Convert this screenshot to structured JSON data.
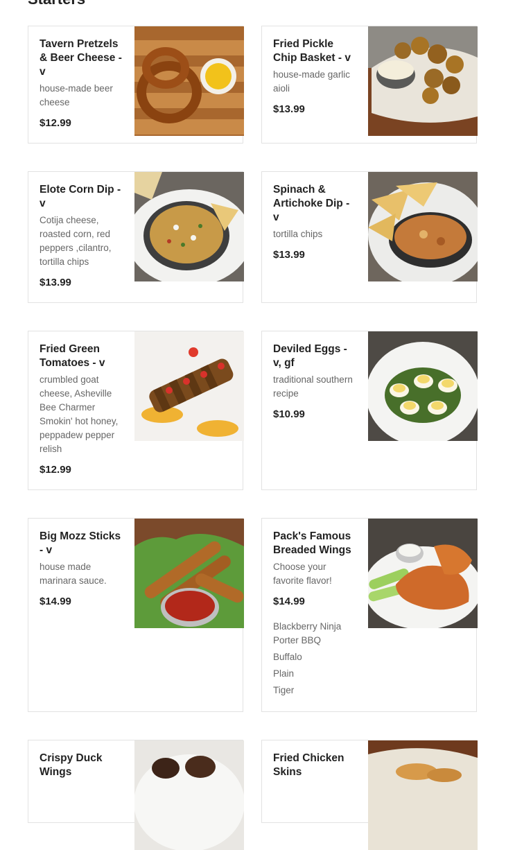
{
  "section": {
    "title": "Starters"
  },
  "items": [
    {
      "name": "Tavern Pretzels & Beer Cheese - v",
      "desc": "house-made beer cheese",
      "price": "$12.99",
      "image_icon": "pretzel-photo"
    },
    {
      "name": "Fried Pickle Chip Basket - v",
      "desc": "house-made garlic aioli",
      "price": "$13.99",
      "image_icon": "fried-pickle-photo"
    },
    {
      "name": "Elote Corn Dip - v",
      "desc": "Cotija cheese, roasted corn, red peppers ,cilantro, tortilla chips",
      "price": "$13.99",
      "image_icon": "corn-dip-photo"
    },
    {
      "name": "Spinach & Artichoke Dip - v",
      "desc": "tortilla chips",
      "price": "$13.99",
      "image_icon": "spinach-dip-photo"
    },
    {
      "name": "Fried Green Tomatoes - v",
      "desc": "crumbled goat cheese, Asheville Bee Charmer Smokin' hot honey, peppadew pepper relish",
      "price": "$12.99",
      "image_icon": "green-tomatoes-photo"
    },
    {
      "name": "Deviled Eggs - v, gf",
      "desc": "traditional southern recipe",
      "price": "$10.99",
      "image_icon": "deviled-eggs-photo"
    },
    {
      "name": "Big Mozz Sticks - v",
      "desc": "house made marinara sauce.",
      "price": "$14.99",
      "image_icon": "mozz-sticks-photo"
    },
    {
      "name": "Pack's Famous Breaded Wings",
      "desc": "Choose your favorite flavor!",
      "price": "$14.99",
      "image_icon": "wings-photo",
      "options": [
        "Blackberry Ninja Porter BBQ",
        "Buffalo",
        "Plain",
        "Tiger"
      ]
    },
    {
      "name": "Crispy Duck Wings",
      "image_icon": "duck-wings-photo"
    },
    {
      "name": "Fried Chicken Skins",
      "image_icon": "chicken-skins-photo"
    }
  ]
}
